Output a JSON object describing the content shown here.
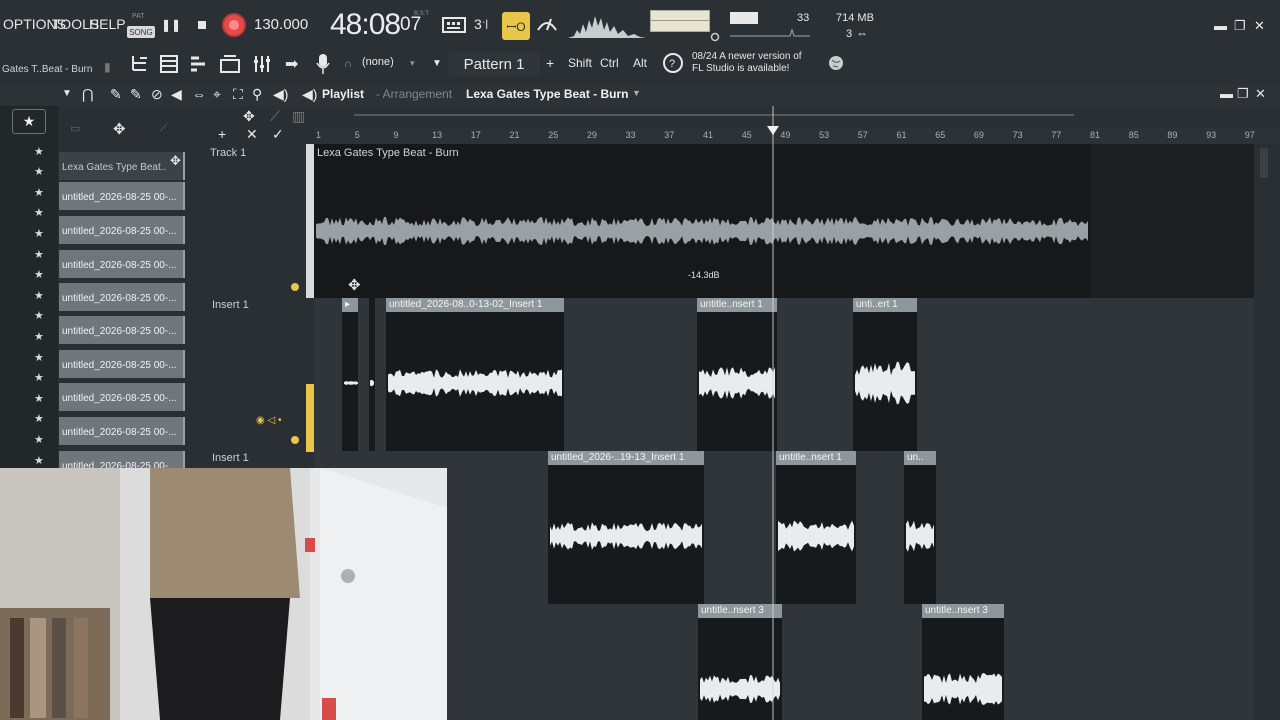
{
  "menu": {
    "options": "OPTIONS",
    "tools": "TOOLS",
    "help": "HELP"
  },
  "transport": {
    "mode_label": "PAT",
    "mode_button": "SONG",
    "tempo": "130.000",
    "time_main": "48:08",
    "time_sub": "07",
    "time_label": "B:S:T"
  },
  "snap_icon_label": "ꟷO",
  "stats": {
    "cpu_value": "33",
    "memory": "714 MB",
    "polyphony": "3"
  },
  "hint": "Gates T..Beat - Burn",
  "channel_select": "(none)",
  "pattern": {
    "label": "Pattern 1",
    "add": "+"
  },
  "keys": {
    "shift": "Shift",
    "ctrl": "Ctrl",
    "alt": "Alt"
  },
  "news": {
    "date": "08/24",
    "line1": "A newer version of",
    "line2": "FL Studio is available!"
  },
  "playlist": {
    "title": "Playlist",
    "sub": "- Arrangement",
    "song_name": "Lexa Gates Type Beat - Burn"
  },
  "ruler_ticks": [
    "1",
    "5",
    "9",
    "13",
    "17",
    "21",
    "25",
    "29",
    "33",
    "37",
    "41",
    "45",
    "49",
    "53",
    "57",
    "61",
    "65",
    "69",
    "73",
    "77",
    "81",
    "85",
    "89",
    "93",
    "97"
  ],
  "browser": {
    "first_item": "Lexa Gates Type Beat..",
    "items": [
      "untitled_2026-08-25 00-...",
      "untitled_2026-08-25 00-...",
      "untitled_2026-08-25 00-...",
      "untitled_2026-08-25 00-...",
      "untitled_2026-08-25 00-...",
      "untitled_2026-08-25 00-...",
      "untitled_2026-08-25 00-...",
      "untitled_2026-08-25 00-...",
      "untitled_2026-08-25 00-..."
    ]
  },
  "tracks": {
    "track1": "Track 1",
    "insert_a": "Insert 1",
    "insert_b": "Insert 1"
  },
  "clips": {
    "main_audio": "Lexa Gates Type Beat - Burn",
    "a1": "untitled_2026-08..0-13-02_Insert 1",
    "a2": "untitle..nsert 1",
    "a3": "unti..ert 1",
    "b1": "untitled_2026-..19-13_Insert 1",
    "b2": "untitle..nsert 1",
    "b3": "un..",
    "c1": "untitle..nsert 3",
    "c2": "untitle..nsert 3"
  },
  "volume_hint": "-14.3dB",
  "colors": {
    "accent": "#e8c64a",
    "record": "#e84a4a",
    "clip_header": "#8e979c",
    "background": "#2a2f33"
  }
}
